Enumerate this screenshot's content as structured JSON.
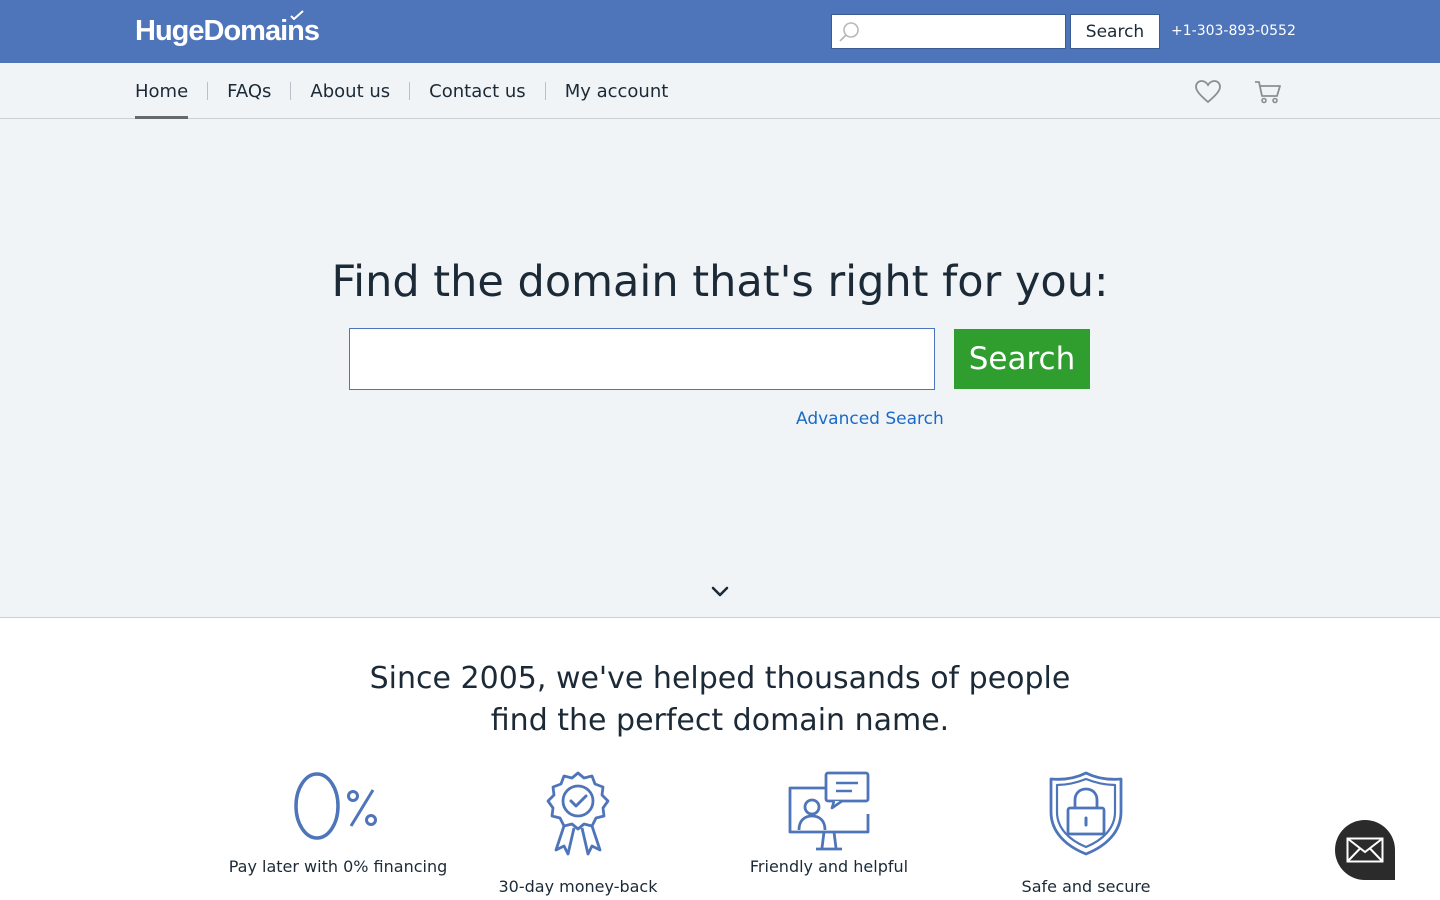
{
  "header": {
    "logo_text": "HugeDomains",
    "search_placeholder": "",
    "search_button": "Search",
    "phone": "+1-303-893-0552"
  },
  "nav": {
    "items": [
      {
        "label": "Home",
        "active": true
      },
      {
        "label": "FAQs"
      },
      {
        "label": "About us"
      },
      {
        "label": "Contact us"
      },
      {
        "label": "My account"
      }
    ],
    "icons": [
      "heart-icon",
      "cart-icon"
    ]
  },
  "hero": {
    "title": "Find the domain that's right for you:",
    "search_placeholder": "",
    "search_button": "Search",
    "advanced_search": "Advanced Search"
  },
  "about": {
    "headline_line1": "Since 2005, we've helped thousands of people",
    "headline_line2": "find the perfect domain name.",
    "features": [
      {
        "icon": "zero-percent-icon",
        "label": "Pay later with 0% financing"
      },
      {
        "icon": "award-ribbon-icon",
        "label": "30-day money-back"
      },
      {
        "icon": "support-agent-icon",
        "label": "Friendly and helpful"
      },
      {
        "icon": "shield-lock-icon",
        "label": "Safe and secure"
      }
    ]
  },
  "colors": {
    "brand_blue": "#4e74b9",
    "action_green": "#2f9e2f",
    "link_blue": "#1a6bc7",
    "icon_blue": "#4e74b9"
  }
}
